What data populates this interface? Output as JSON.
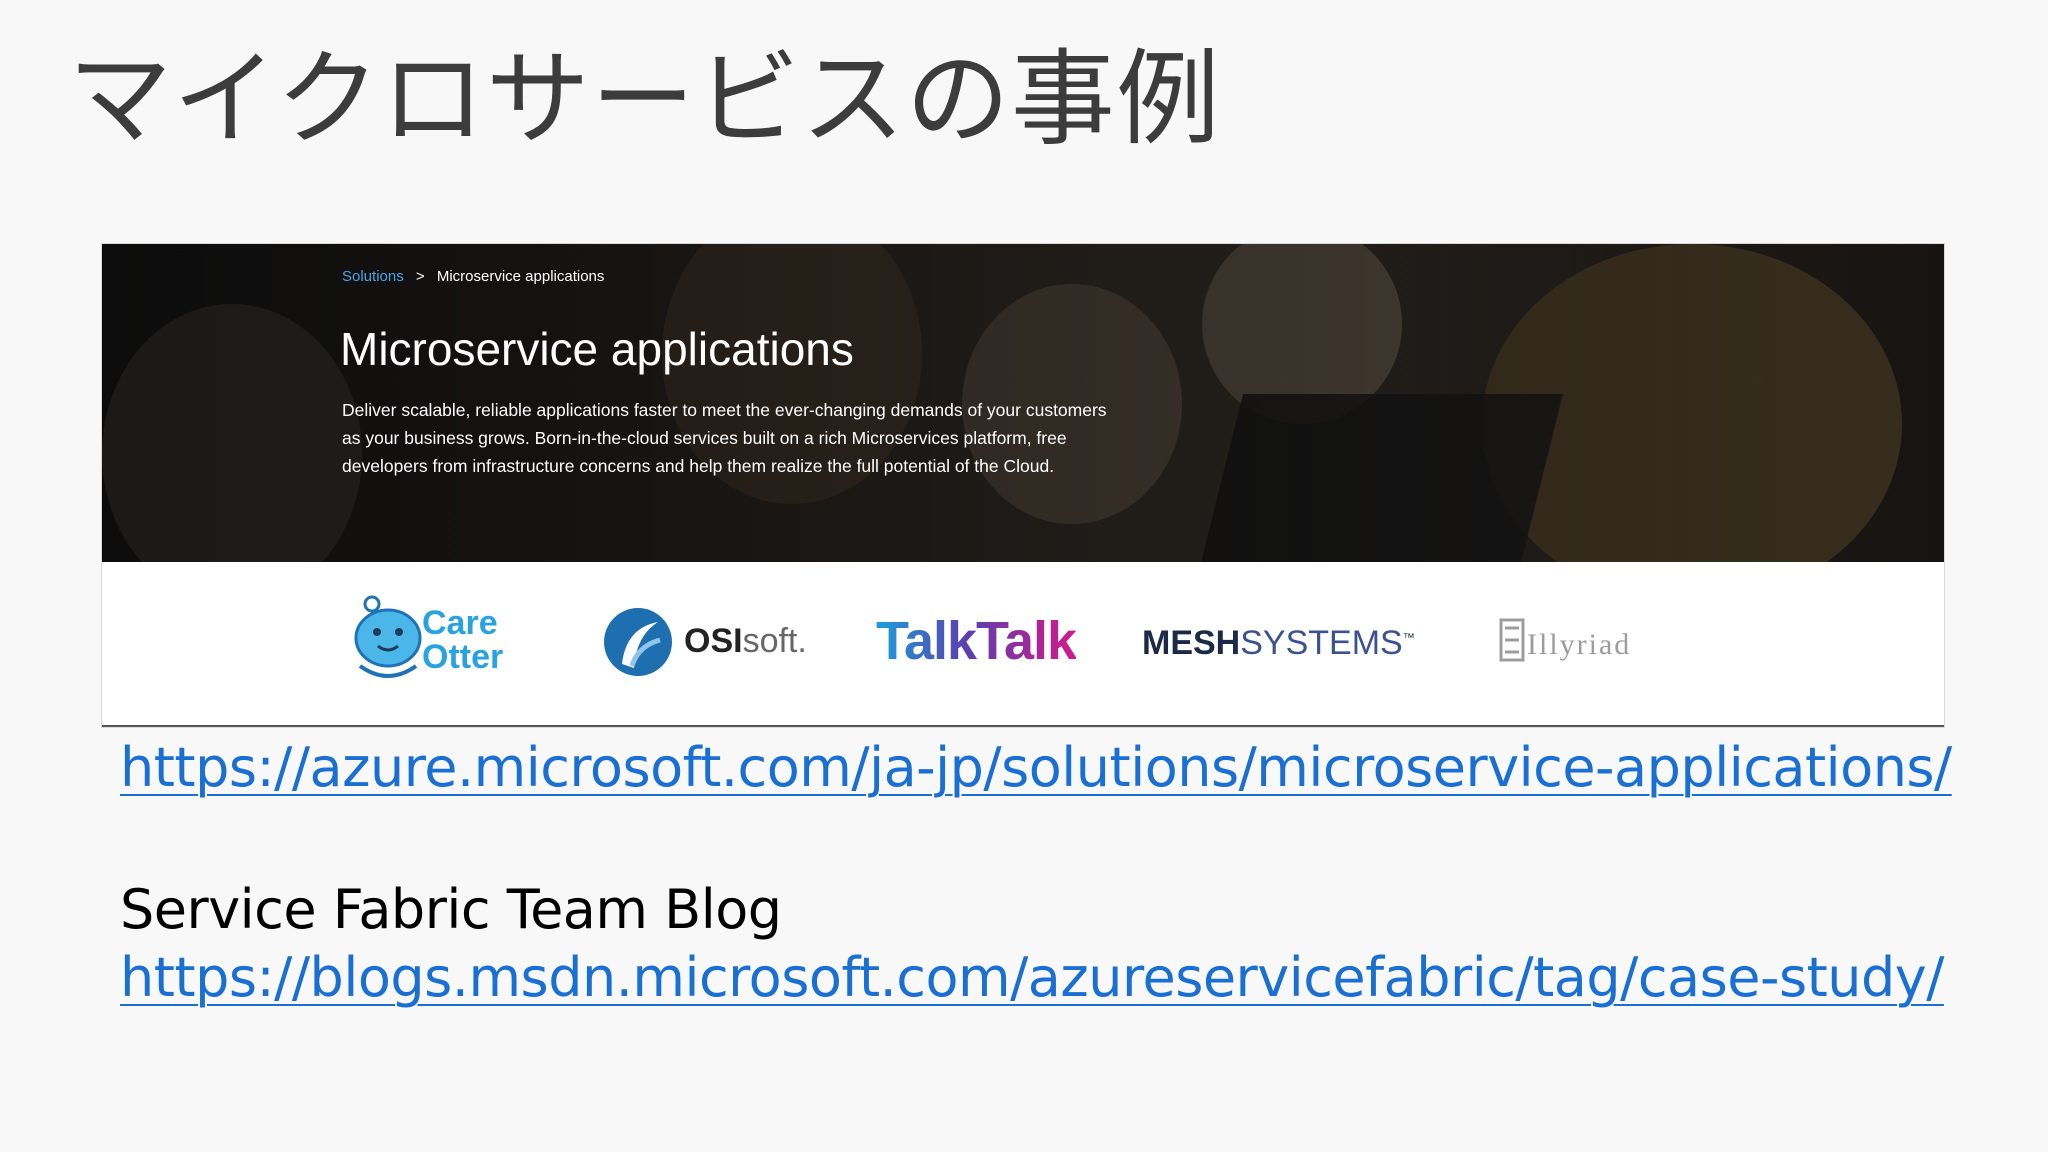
{
  "slide": {
    "title": "マイクロサービスの事例"
  },
  "screenshot": {
    "breadcrumb": {
      "link": "Solutions",
      "separator": ">",
      "current": "Microservice applications"
    },
    "hero_title": "Microservice applications",
    "hero_description": "Deliver scalable, reliable applications faster to meet the ever-changing demands of your customers as your business grows. Born-in-the-cloud services built on a rich Microservices platform, free developers from infrastructure concerns and help them realize the full potential of the Cloud.",
    "logos": {
      "careotter_line1": "Care",
      "careotter_line2": "Otter",
      "osisoft_bold": "OSI",
      "osisoft_rest": "soft.",
      "talktalk": "TalkTalk",
      "mesh_bold": "MESH",
      "mesh_rest": "SYSTEMS",
      "mesh_tm": "™",
      "illyriad": "Illyriad"
    }
  },
  "links": {
    "azure_url": "https://azure.microsoft.com/ja-jp/solutions/microservice-applications/",
    "blog_heading": "Service Fabric Team Blog",
    "blog_url": "https://blogs.msdn.microsoft.com/azureservicefabric/tag/case-study/"
  },
  "colors": {
    "link": "#1a6fd4",
    "breadcrumb_link": "#4aa3e8",
    "careotter": "#29a3df",
    "osisoft_icon": "#1e6fb0"
  }
}
